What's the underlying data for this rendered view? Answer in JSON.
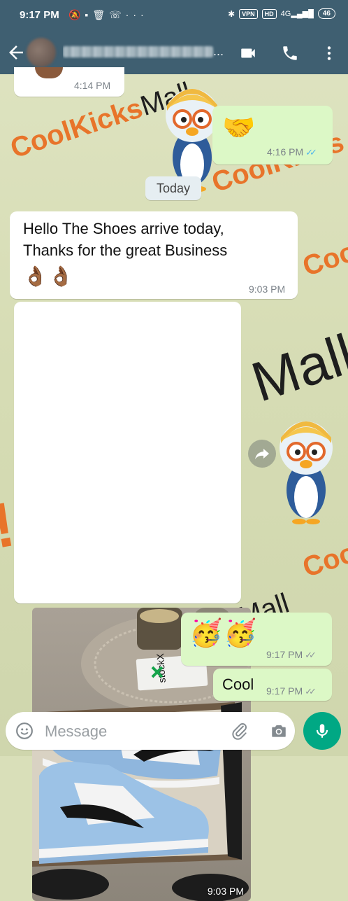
{
  "status_bar": {
    "time": "9:17 PM",
    "icons": [
      "mute-icon",
      "message-icon",
      "delete-icon",
      "wifi-call-icon",
      "more-dots"
    ],
    "vpn": "VPN",
    "hd": "HD",
    "network": "4G",
    "battery": "46"
  },
  "header": {
    "contact_name": "Baloj...",
    "contact_name_visible_suffix": "...",
    "back_icon": "arrow-left-icon",
    "video_icon": "video-call-icon",
    "call_icon": "phone-icon",
    "menu_icon": "more-vertical-icon"
  },
  "watermark": {
    "brand_orange": "CoolKicks",
    "brand_dark": "Mall"
  },
  "messages": [
    {
      "id": "m1",
      "direction": "incoming",
      "time": "4:14 PM"
    },
    {
      "id": "m2",
      "direction": "outgoing",
      "emoji": "🤝",
      "time": "4:16 PM",
      "status": "read"
    },
    {
      "id": "m3",
      "direction": "incoming",
      "text_line1": "Hello The Shoes arrive today,",
      "text_line2": "Thanks for the great Business",
      "emoji": "👌🏾👌🏾",
      "time": "9:03 PM"
    },
    {
      "id": "m4",
      "direction": "incoming",
      "type": "image",
      "image_caption_label": "stockX",
      "time": "9:03 PM"
    },
    {
      "id": "m5",
      "direction": "outgoing",
      "emoji": "🥳🥳",
      "time": "9:17 PM",
      "status": "delivered"
    },
    {
      "id": "m6",
      "direction": "outgoing",
      "text": "Cool",
      "time": "9:17 PM",
      "status": "delivered"
    }
  ],
  "date_divider": "Today",
  "input": {
    "placeholder": "Message",
    "emoji_icon": "emoji-icon",
    "attach_icon": "paperclip-icon",
    "camera_icon": "camera-icon",
    "mic_icon": "mic-icon"
  },
  "colors": {
    "header": "#3f5f71",
    "outgoing_bubble": "#dcf8c6",
    "incoming_bubble": "#ffffff",
    "read_ticks": "#4fb6ec",
    "mic_button": "#00a884",
    "watermark_orange": "#e8742a"
  }
}
